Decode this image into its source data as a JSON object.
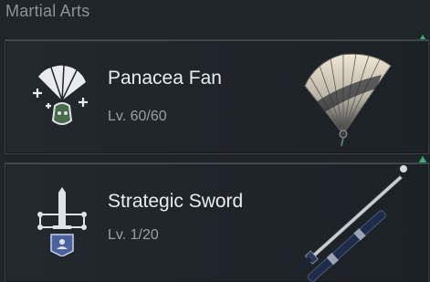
{
  "section": {
    "title": "Martial Arts"
  },
  "skills": [
    {
      "name": "Panacea Fan",
      "level": "Lv. 60/60",
      "icon": "fan-heal-icon",
      "weapon": "fan-weapon-art"
    },
    {
      "name": "Strategic Sword",
      "level": "Lv. 1/20",
      "icon": "sword-strategy-icon",
      "weapon": "sword-weapon-art"
    }
  ],
  "colors": {
    "upgrade_arrow": "#3fb07a",
    "background": "#20252a"
  }
}
